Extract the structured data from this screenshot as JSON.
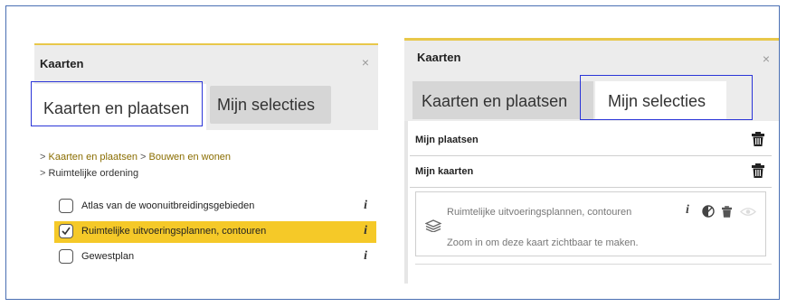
{
  "left_panel": {
    "title": "Kaarten",
    "close_glyph": "×",
    "tabs": [
      {
        "label": "Kaarten en plaatsen",
        "active": true
      },
      {
        "label": "Mijn selecties",
        "active": false
      }
    ],
    "breadcrumb": {
      "line1": [
        "Kaarten en plaatsen",
        "Bouwen en wonen"
      ],
      "line2": "Ruimtelijke ordening",
      "separator": ">"
    },
    "items": [
      {
        "label": "Atlas van de woonuitbreidingsgebieden",
        "checked": false,
        "info": "i"
      },
      {
        "label": "Ruimtelijke uitvoeringsplannen, contouren",
        "checked": true,
        "info": "i"
      },
      {
        "label": "Gewestplan",
        "checked": false,
        "info": "i"
      }
    ]
  },
  "right_panel": {
    "title": "Kaarten",
    "close_glyph": "×",
    "tabs": [
      {
        "label": "Kaarten en plaatsen",
        "active": false
      },
      {
        "label": "Mijn selecties",
        "active": true
      }
    ],
    "sections": [
      {
        "label": "Mijn plaatsen",
        "icon": "trash-icon"
      },
      {
        "label": "Mijn kaarten",
        "icon": "trash-icon"
      }
    ],
    "map_item": {
      "name": "Ruimtelijke uitvoeringsplannen, contouren",
      "message": "Zoom in om deze kaart zichtbaar te maken.",
      "info": "i",
      "icons": [
        "layers-icon",
        "info-icon",
        "contrast-icon",
        "trash-icon",
        "eye-icon"
      ]
    }
  },
  "colors": {
    "selection": "#f5c928",
    "accent_line": "#e8c84a",
    "header_bg": "#ececec",
    "link": "#8a6d00",
    "highlight_box": "#2b35d8"
  }
}
